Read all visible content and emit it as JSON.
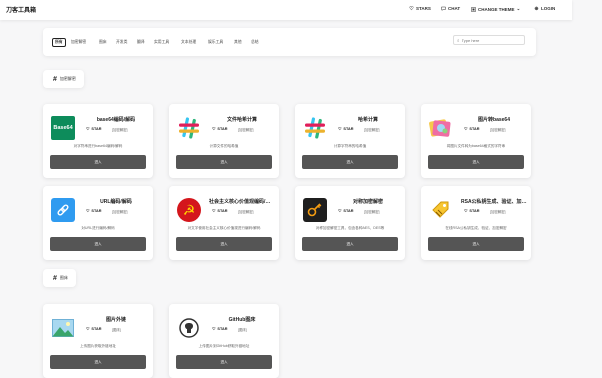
{
  "header": {
    "brand": "刀客工具箱",
    "star": "STARS",
    "chat": "CHAT",
    "theme": "CHANGE THEME",
    "login": "LOGIN"
  },
  "categories": [
    "所有",
    "加密解密",
    "图床",
    "开发类",
    "翻译",
    "实用工具",
    "文本处理",
    "娱乐工具",
    "其他",
    "总结"
  ],
  "search": {
    "placeholder": "Type here"
  },
  "sections": [
    {
      "title": "加密解密",
      "cards": [
        {
          "title": "base64编码/解码",
          "star": "STAR",
          "tag": "[加密解密]",
          "desc": "对字符串进行base64编码/解码",
          "button": "进入",
          "icon": "base64-icon"
        },
        {
          "title": "文件哈希计算",
          "star": "STAR",
          "tag": "[加密解密]",
          "desc": "计算文件的哈希值",
          "button": "进入",
          "icon": "hash-icon"
        },
        {
          "title": "哈希计算",
          "star": "STAR",
          "tag": "[加密解密]",
          "desc": "计算字符串的哈希值",
          "button": "进入",
          "icon": "hash-icon"
        },
        {
          "title": "图片转base64",
          "star": "STAR",
          "tag": "[加密解密]",
          "desc": "将图片文件转为base64格式的字符串",
          "button": "进入",
          "icon": "photos-icon"
        },
        {
          "title": "URL编码/解码",
          "star": "STAR",
          "tag": "[加密解密]",
          "desc": "对URL进行编码/解码",
          "button": "进入",
          "icon": "link-icon"
        },
        {
          "title": "社会主义核心价值观编码/解码",
          "star": "STAR",
          "tag": "[加密解密]",
          "desc": "对文字使用社会主义核心价值观进行编码/解码",
          "button": "进入",
          "icon": "hammer-sickle-icon"
        },
        {
          "title": "对称加密解密",
          "star": "STAR",
          "tag": "[加密解密]",
          "desc": "对称加密解密工具，包含各种AES、DES等",
          "button": "进入",
          "icon": "key-icon"
        },
        {
          "title": "RSA公私钥生成、验证、加解密",
          "star": "STAR",
          "tag": "[加密解密]",
          "desc": "在线RSA公私钥生成、验证、加密解密",
          "button": "进入",
          "icon": "tag-key-icon"
        }
      ]
    },
    {
      "title": "图床",
      "cards": [
        {
          "title": "图片外链",
          "star": "STAR",
          "tag": "[图床]",
          "desc": "上传图片获取外链地址",
          "button": "进入",
          "icon": "image-icon"
        },
        {
          "title": "GitHub图床",
          "star": "STAR",
          "tag": "[图床]",
          "desc": "上传图片到GitHub获取外链地址",
          "button": "进入",
          "icon": "github-icon"
        }
      ]
    }
  ],
  "colors": {
    "base64_bg": "#0d8c5b",
    "url_bg": "#2f9bf0",
    "button": "#555555",
    "hammer_bg": "#d4161c",
    "key_bg": "#1f1f1f"
  }
}
